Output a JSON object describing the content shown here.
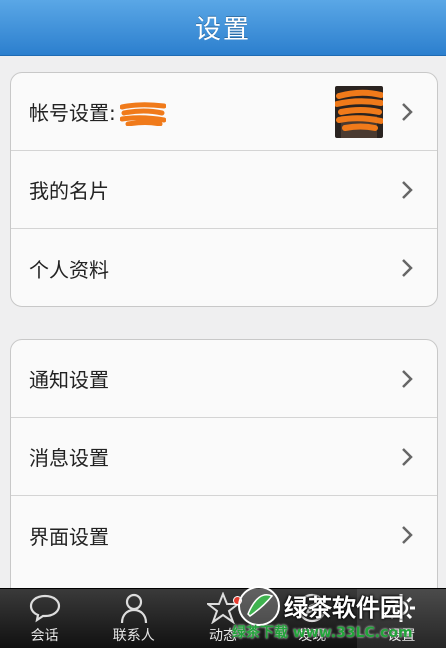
{
  "navbar": {
    "title": "设置"
  },
  "group1": [
    {
      "label": "帐号设置:"
    },
    {
      "label": "我的名片"
    },
    {
      "label": "个人资料"
    }
  ],
  "group2": [
    {
      "label": "通知设置"
    },
    {
      "label": "消息设置"
    },
    {
      "label": "界面设置"
    }
  ],
  "tabbar": {
    "tabs": [
      {
        "label": "会话",
        "icon": "chat-bubble-icon"
      },
      {
        "label": "联系人",
        "icon": "person-icon"
      },
      {
        "label": "动态",
        "icon": "star-icon",
        "badge": "dot"
      },
      {
        "label": "发现",
        "icon": "discover-icon"
      },
      {
        "label": "设置",
        "icon": "gear-icon",
        "active": true
      }
    ]
  },
  "watermark": {
    "title": "绿茶软件园",
    "url": "绿茶下载 www.33LC.com"
  },
  "colors": {
    "navbar": "#2c7fce",
    "redaction": "#f07a1a",
    "badge": "#e53a2d",
    "tabbar": "#1a1a1a"
  }
}
